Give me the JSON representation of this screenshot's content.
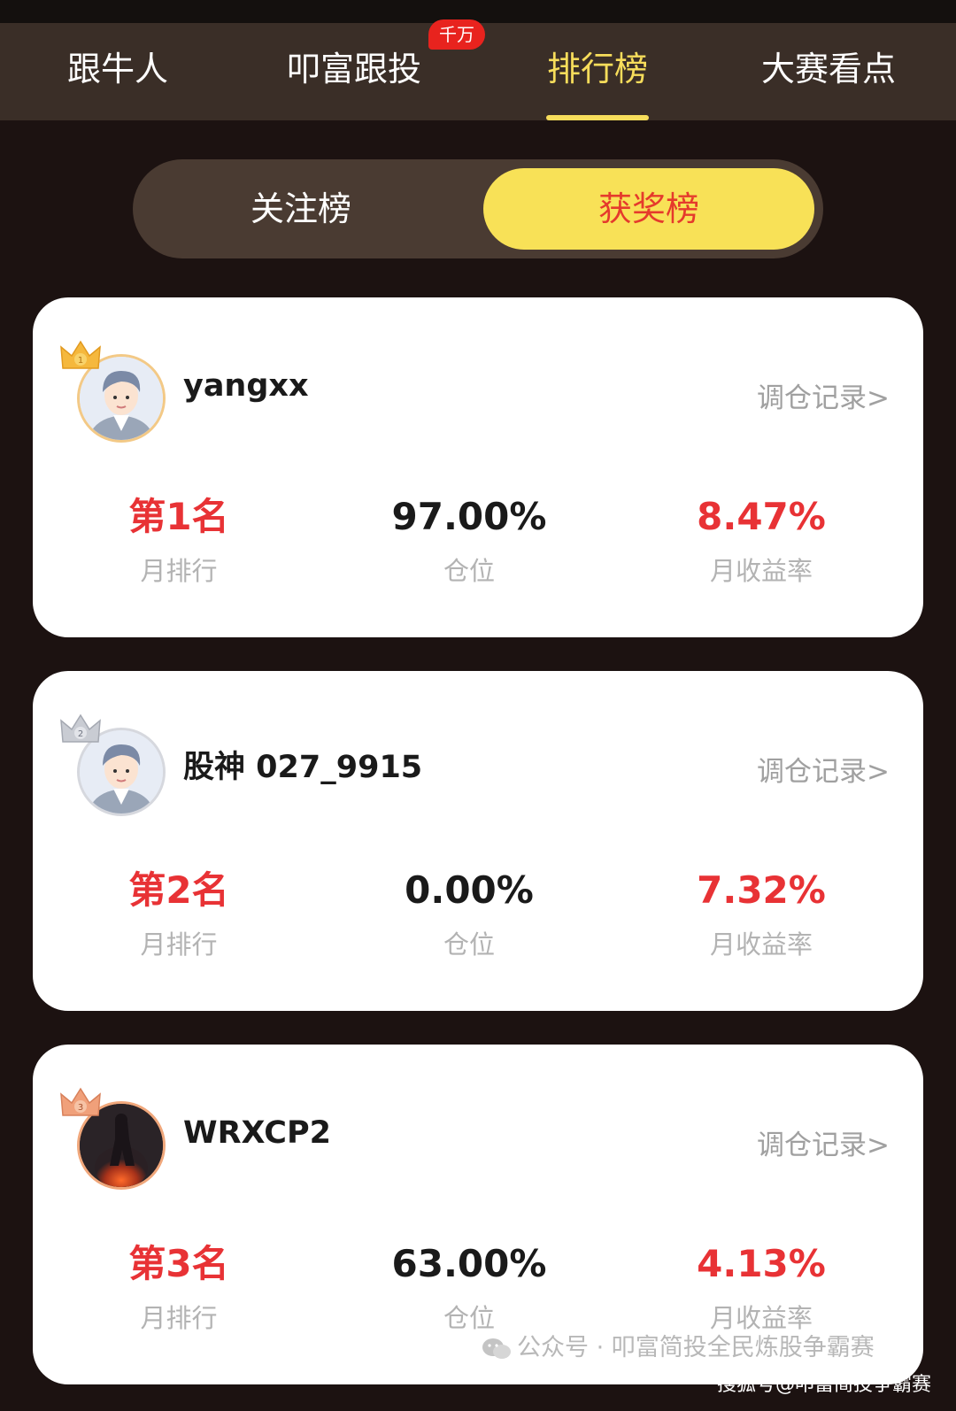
{
  "nav": {
    "tabs": [
      {
        "label": "跟牛人"
      },
      {
        "label": "叩富跟投"
      },
      {
        "label": "排行榜"
      },
      {
        "label": "大赛看点"
      }
    ],
    "active_tab": "排行榜",
    "badge": "千万"
  },
  "segment": {
    "options": [
      "关注榜",
      "获奖榜"
    ],
    "selected": "获奖榜"
  },
  "leaderboard": [
    {
      "username": "yangxx",
      "link": "调仓记录>",
      "rank": "第1名",
      "rank_label": "月排行",
      "position": "97.00%",
      "position_label": "仓位",
      "return": "8.47%",
      "return_label": "月收益率",
      "crown": "gold-crown-1",
      "crown_num": "1"
    },
    {
      "username": "股神 027_9915",
      "link": "调仓记录>",
      "rank": "第2名",
      "rank_label": "月排行",
      "position": "0.00%",
      "position_label": "仓位",
      "return": "7.32%",
      "return_label": "月收益率",
      "crown": "silver-crown-2",
      "crown_num": "2"
    },
    {
      "username": "WRXCP2",
      "link": "调仓记录>",
      "rank": "第3名",
      "rank_label": "月排行",
      "position": "63.00%",
      "position_label": "仓位",
      "return": "4.13%",
      "return_label": "月收益率",
      "crown": "bronze-crown-3",
      "crown_num": "3"
    }
  ],
  "watermark": {
    "wechat": "公众号 · 叩富简投全民炼股争霸赛",
    "sohu": "搜狐号@叩富简投争霸赛"
  },
  "colors": {
    "background": "#1c1211",
    "nav_bg": "#3a2e27",
    "accent_yellow": "#f7dd5b",
    "rank_red": "#e83235"
  }
}
